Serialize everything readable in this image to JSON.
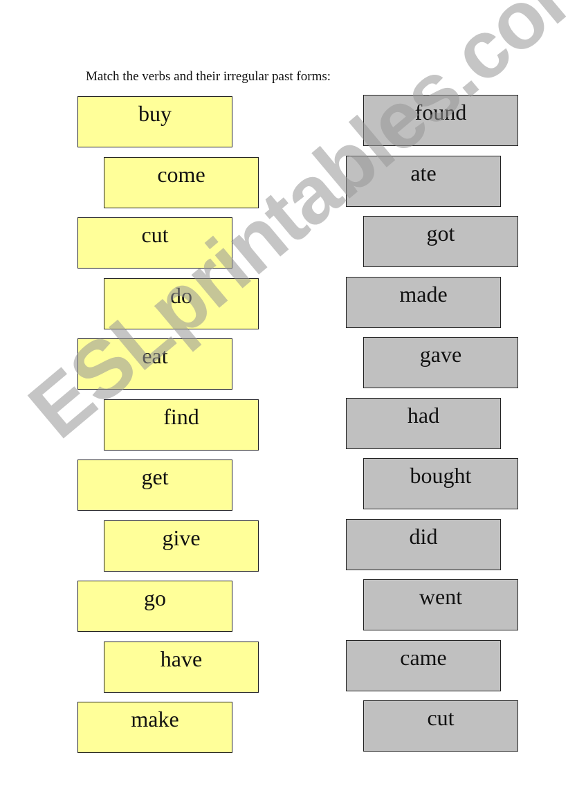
{
  "title": "Match the verbs and their irregular past forms:",
  "verbs": [
    "buy",
    "come",
    "cut",
    "do",
    "eat",
    "find",
    "get",
    "give",
    "go",
    "have",
    "make"
  ],
  "past_forms": [
    "found",
    "ate",
    "got",
    "made",
    "gave",
    "had",
    "bought",
    "did",
    "went",
    "came",
    "cut"
  ],
  "watermark": "ESLprintables.com",
  "colors": {
    "verb_card": "#ffff99",
    "past_card": "#c0c0c0"
  }
}
